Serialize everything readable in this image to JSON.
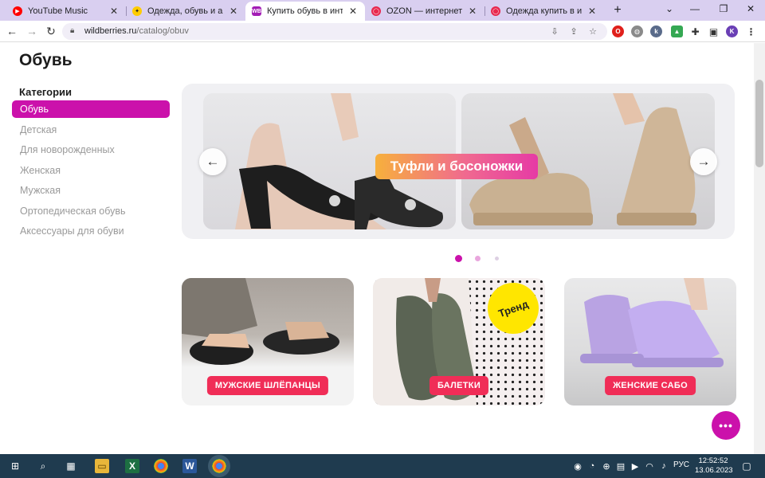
{
  "browser": {
    "tabs": [
      {
        "title": "YouTube Music",
        "icon": "youtube-music-icon",
        "color": "#ff0000"
      },
      {
        "title": "Одежда, обувь и аксессуа",
        "icon": "yandex-market-icon",
        "color": "#ffcc00"
      },
      {
        "title": "Купить обувь в интернет-",
        "icon": "wildberries-icon",
        "color": "#a31db5",
        "icon_text": "WB"
      },
      {
        "title": "OZON — интернет-магазин",
        "icon": "ozon-icon",
        "color": "#e8284e"
      },
      {
        "title": "Одежда купить в интерне",
        "icon": "ozon-icon",
        "color": "#e8284e"
      }
    ],
    "close_glyph": "✕",
    "new_tab_glyph": "+",
    "url_domain": "wildberries.ru",
    "url_path": "/catalog/obuv",
    "profile_initial": "K"
  },
  "page": {
    "title": "Обувь",
    "categories_title": "Категории",
    "categories": [
      "Обувь",
      "Детская",
      "Для новорожденных",
      "Женская",
      "Мужская",
      "Ортопедическая обувь",
      "Аксессуары для обуви"
    ],
    "active_category_index": 0,
    "banner": {
      "label": "Туфли и босоножки",
      "prev_glyph": "←",
      "next_glyph": "→",
      "dots_count": 3,
      "active_dot": 0
    },
    "cards": [
      {
        "button": "МУЖСКИЕ ШЛЁПАНЦЫ"
      },
      {
        "button": "БАЛЕТКИ",
        "badge": "Тренд"
      },
      {
        "button": "ЖЕНСКИЕ САБО"
      }
    ],
    "chat_glyph": "•••",
    "accent_color": "#cb11ab",
    "button_color": "#f02d57"
  },
  "taskbar": {
    "language": "РУС",
    "time": "12:52:52",
    "date": "13.06.2023"
  }
}
